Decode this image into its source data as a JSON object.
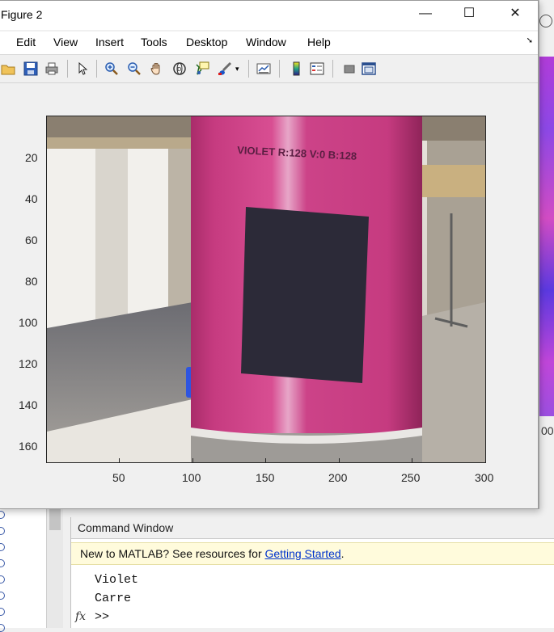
{
  "figure": {
    "title": "Figure 2",
    "window_controls": {
      "minimize": "—",
      "maximize": "☐",
      "close": "✕"
    }
  },
  "menubar": {
    "items": [
      {
        "label": "Edit"
      },
      {
        "label": "View"
      },
      {
        "label": "Insert"
      },
      {
        "label": "Tools"
      },
      {
        "label": "Desktop"
      },
      {
        "label": "Window"
      },
      {
        "label": "Help"
      }
    ]
  },
  "toolbar": {
    "icons": [
      "open-file-icon",
      "save-icon",
      "print-icon",
      "pointer-icon",
      "zoom-in-icon",
      "zoom-out-icon",
      "pan-hand-icon",
      "rotate-3d-icon",
      "data-cursor-icon",
      "brush-icon",
      "brush-dropdown-icon",
      "link-plot-icon",
      "colorbar-icon",
      "legend-icon",
      "hide-plot-tools-icon",
      "show-plot-tools-icon"
    ]
  },
  "axes": {
    "image_text": "VIOLET R:128 V:0 B:128",
    "x_ticks": [
      "50",
      "100",
      "150",
      "200",
      "250",
      "300"
    ],
    "y_ticks": [
      "20",
      "40",
      "60",
      "80",
      "100",
      "120",
      "140",
      "160"
    ],
    "colors": {
      "tube_pink": "#c8397f",
      "dark_square": "#2b2a3a",
      "floor": "#8d8a86"
    }
  },
  "background_window": {
    "partial_label": "00"
  },
  "command_window": {
    "title": "Command Window",
    "banner_text": "New to MATLAB? See resources for ",
    "banner_link": "Getting Started",
    "banner_end": ".",
    "output_lines": [
      "Violet",
      "Carre"
    ],
    "prompt": ">>",
    "fx_label": "fx"
  }
}
